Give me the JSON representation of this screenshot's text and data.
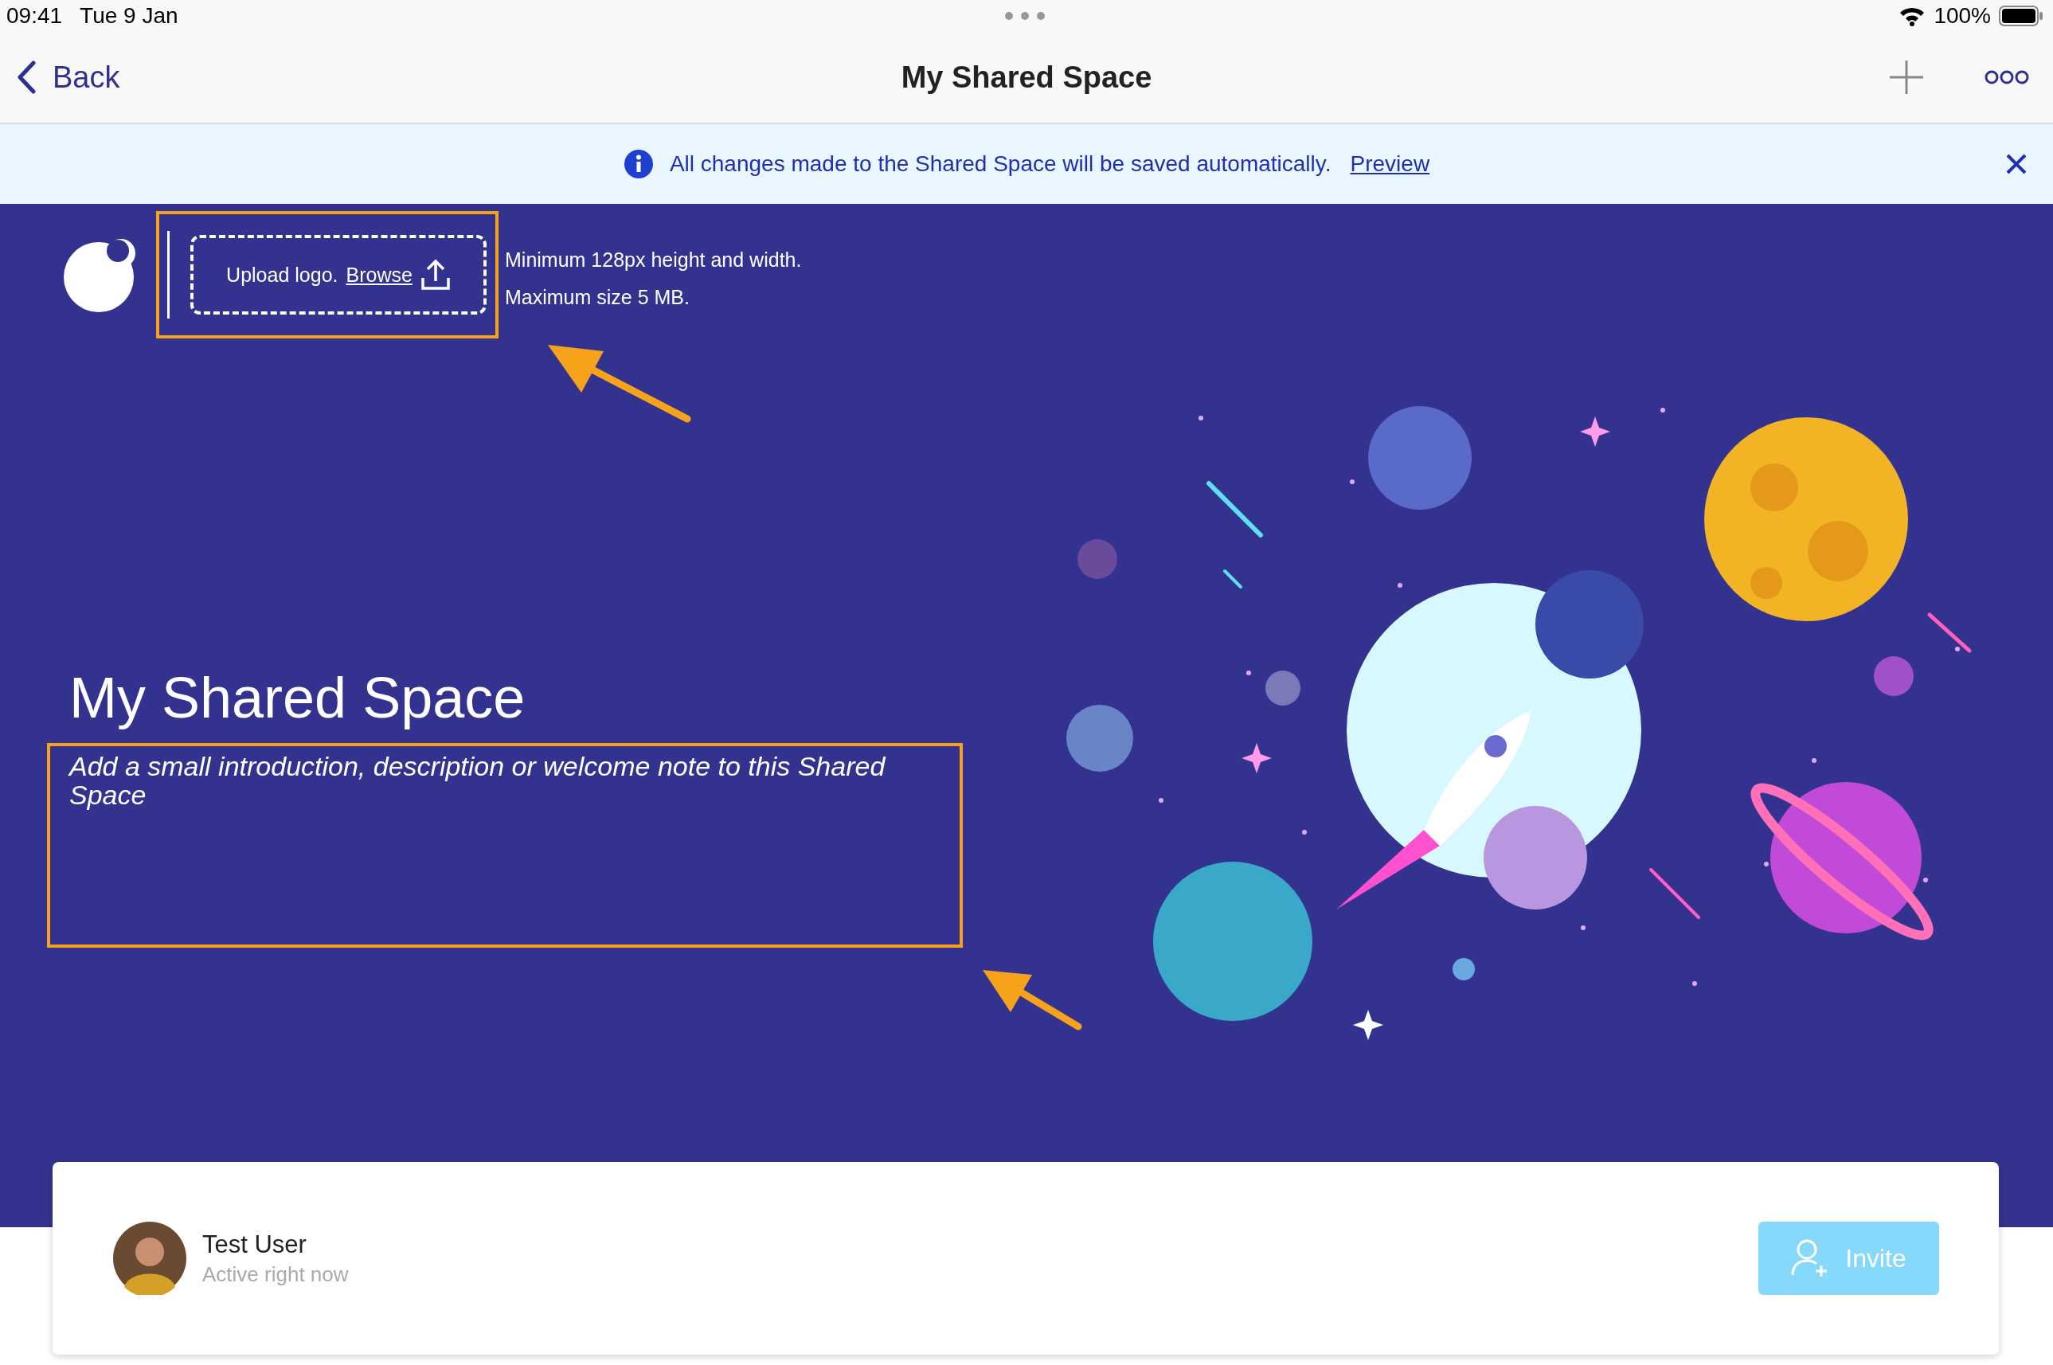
{
  "status_bar": {
    "time": "09:41",
    "date": "Tue 9 Jan",
    "battery": "100%"
  },
  "nav": {
    "back": "Back",
    "title": "My Shared Space"
  },
  "banner": {
    "message": "All changes made to the Shared Space will be saved automatically.",
    "link": "Preview"
  },
  "hero": {
    "upload": {
      "label": "Upload logo.",
      "link": "Browse"
    },
    "hints": [
      "Minimum 128px height and width.",
      "Maximum size 5 MB."
    ],
    "title": "My Shared Space",
    "description": {
      "placeholder": "Add a small introduction, description or welcome note to this Shared Space"
    }
  },
  "member": {
    "name": "Test User",
    "status": "Active right now"
  },
  "invite": {
    "label": "Invite",
    "disabled": true
  }
}
